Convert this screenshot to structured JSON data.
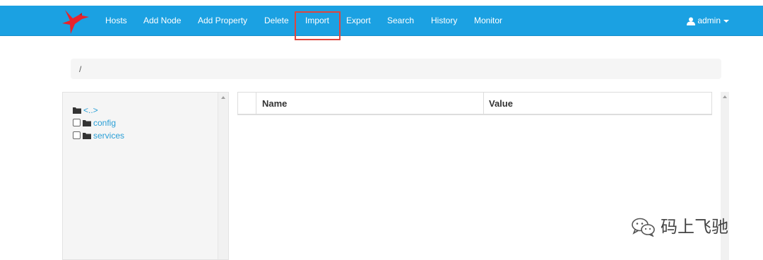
{
  "navbar": {
    "brand_color": "#1ba1e2",
    "items": [
      {
        "label": "Hosts"
      },
      {
        "label": "Add Node"
      },
      {
        "label": "Add Property"
      },
      {
        "label": "Delete"
      },
      {
        "label": "Import",
        "highlighted": true
      },
      {
        "label": "Export"
      },
      {
        "label": "Search"
      },
      {
        "label": "History"
      },
      {
        "label": "Monitor"
      }
    ],
    "user": {
      "label": "admin",
      "icon": "user-icon"
    }
  },
  "breadcrumb": {
    "path": "/"
  },
  "tree": {
    "parent": {
      "label": "<..>",
      "icon": "folder-icon"
    },
    "nodes": [
      {
        "label": "config",
        "checked": false,
        "icon": "folder-icon"
      },
      {
        "label": "services",
        "checked": false,
        "icon": "folder-icon"
      }
    ]
  },
  "table": {
    "columns": [
      "Name",
      "Value"
    ],
    "rows": []
  },
  "watermark": {
    "text": "码上飞驰",
    "icon": "wechat-icon"
  },
  "colors": {
    "highlight": "#e0453d",
    "link": "#2a9fd6"
  }
}
